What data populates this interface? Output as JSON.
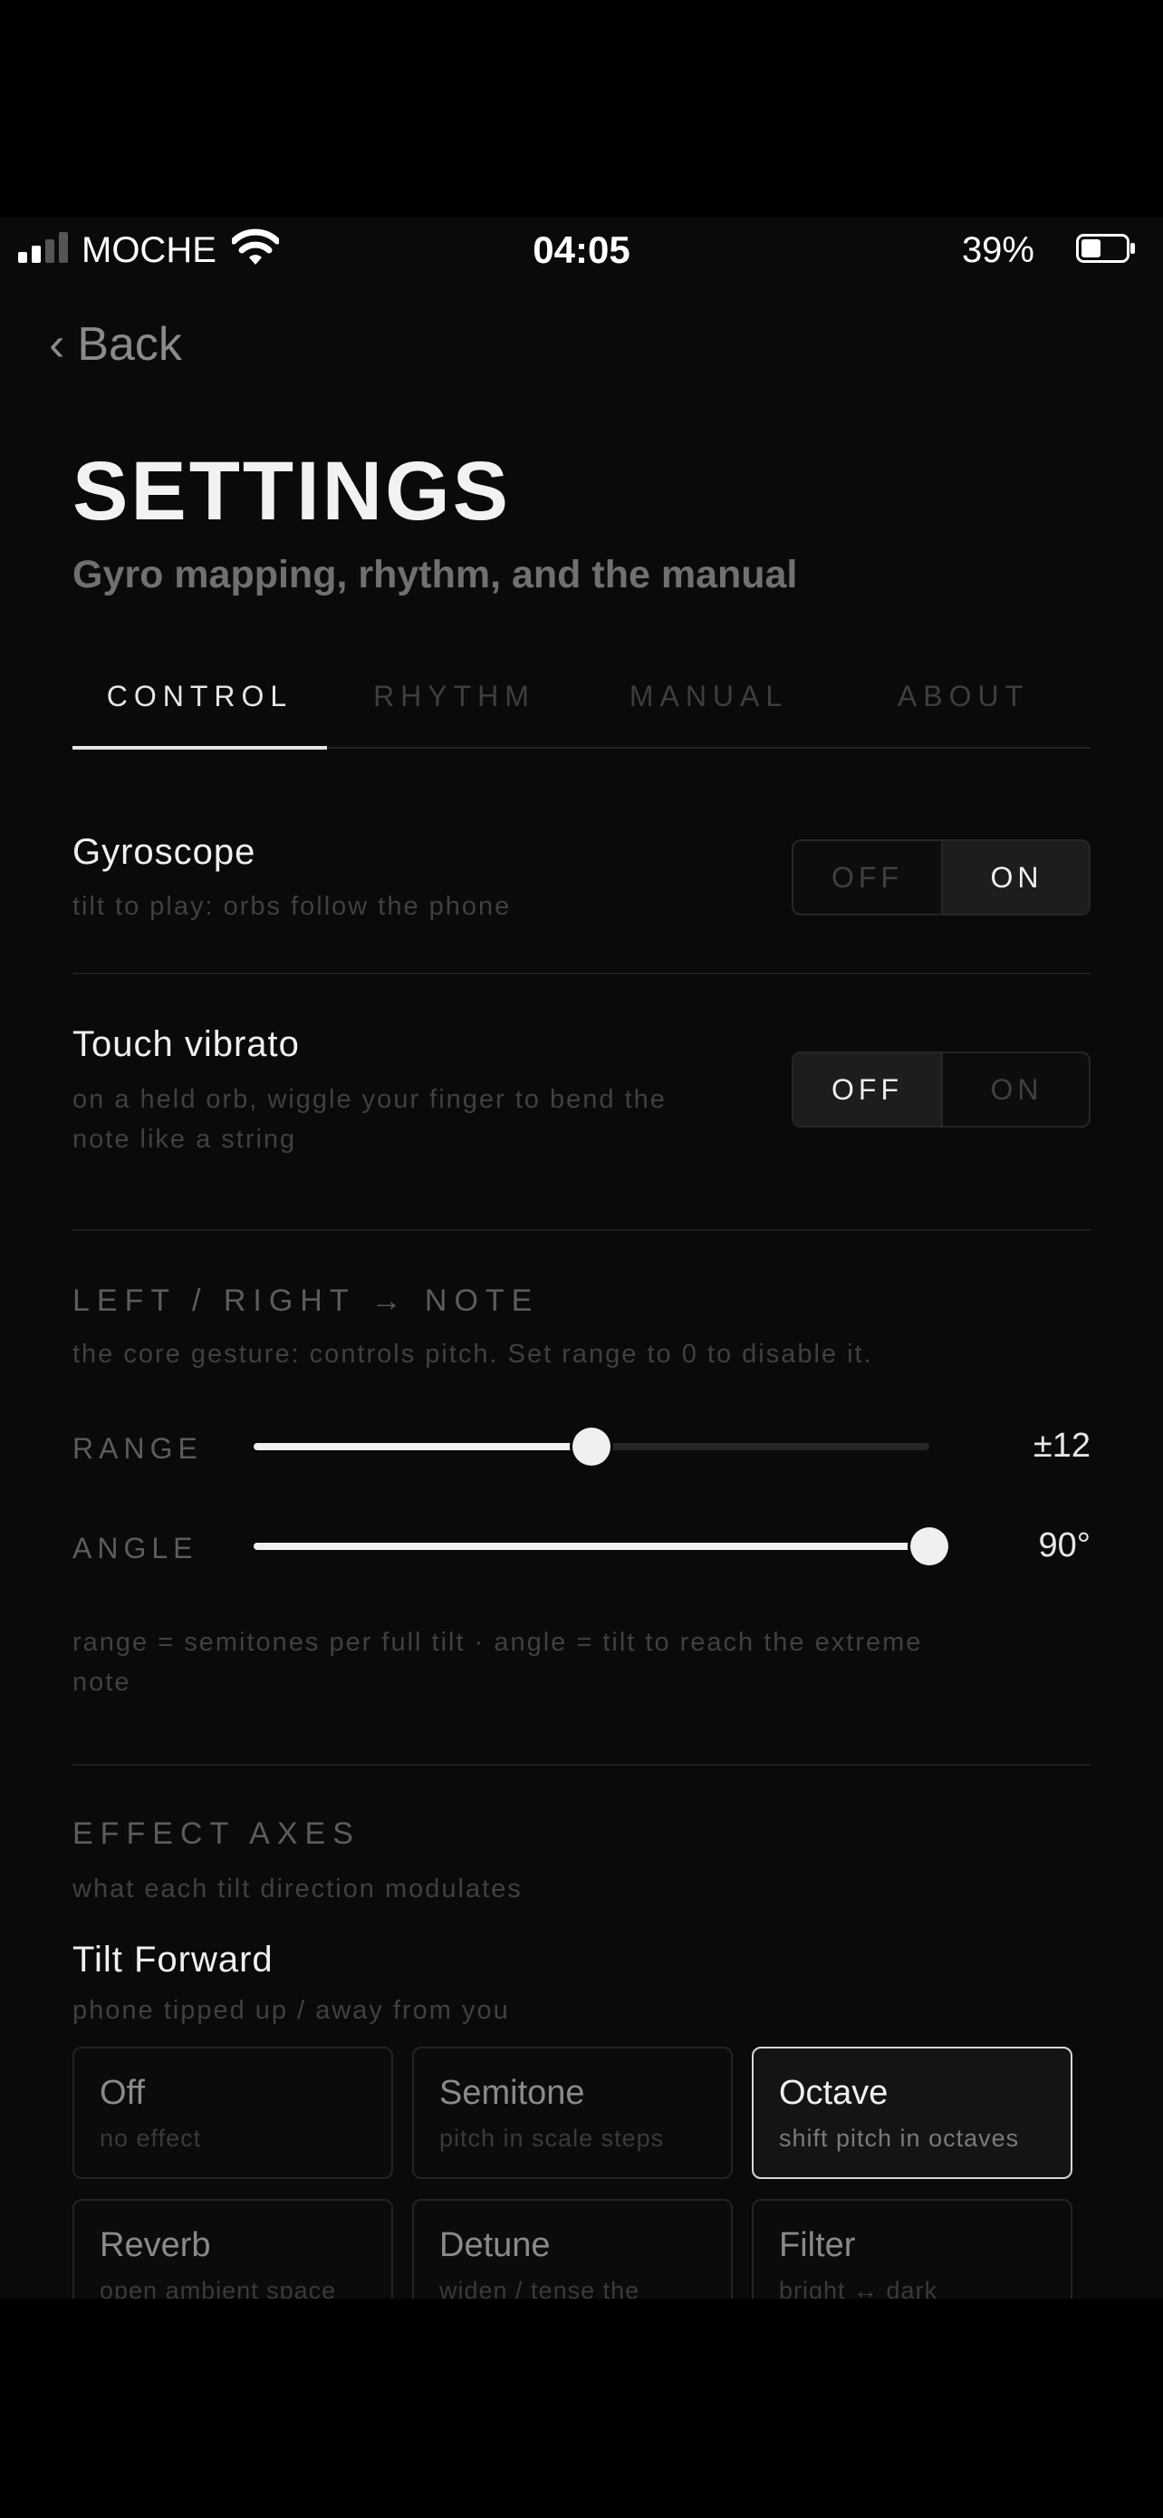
{
  "status": {
    "carrier": "MOCHE",
    "time": "04:05",
    "battery": "39%"
  },
  "nav": {
    "back": "Back"
  },
  "header": {
    "title": "SETTINGS",
    "subtitle": "Gyro mapping, rhythm, and the manual"
  },
  "tabs": [
    {
      "label": "CONTROL",
      "active": true
    },
    {
      "label": "RHYTHM",
      "active": false
    },
    {
      "label": "MANUAL",
      "active": false
    },
    {
      "label": "ABOUT",
      "active": false
    }
  ],
  "gyroscope": {
    "title": "Gyroscope",
    "desc": "tilt to play: orbs follow the phone",
    "off": "OFF",
    "on": "ON",
    "value": "ON"
  },
  "vibrato": {
    "title": "Touch vibrato",
    "desc_line1": "on a held orb, wiggle your finger to bend the",
    "desc_line2": "note like a string",
    "off": "OFF",
    "on": "ON",
    "value": "OFF"
  },
  "note_mapping": {
    "title": "LEFT / RIGHT → NOTE",
    "desc": "the core gesture: controls pitch. Set range to 0 to disable it.",
    "range": {
      "label": "RANGE",
      "value": "±12",
      "fraction": 0.5
    },
    "angle": {
      "label": "ANGLE",
      "value": "90°",
      "fraction": 1.0
    },
    "note_line1": "range = semitones per full tilt · angle = tilt to reach the extreme",
    "note_line2": "note"
  },
  "effect_axes": {
    "title": "EFFECT AXES",
    "desc": "what each tilt direction modulates",
    "tilt_forward": {
      "title": "Tilt Forward",
      "desc": "phone tipped up / away from you"
    },
    "options": [
      {
        "title": "Off",
        "sub": "no effect",
        "selected": false
      },
      {
        "title": "Semitone",
        "sub": "pitch in scale steps",
        "selected": false
      },
      {
        "title": "Octave",
        "sub": "shift pitch in octaves",
        "selected": true
      },
      {
        "title": "Reverb",
        "sub": "open ambient space",
        "selected": false
      },
      {
        "title": "Detune",
        "sub": "widen / tense the",
        "selected": false
      },
      {
        "title": "Filter",
        "sub": "bright ↔ dark",
        "selected": false
      }
    ]
  }
}
